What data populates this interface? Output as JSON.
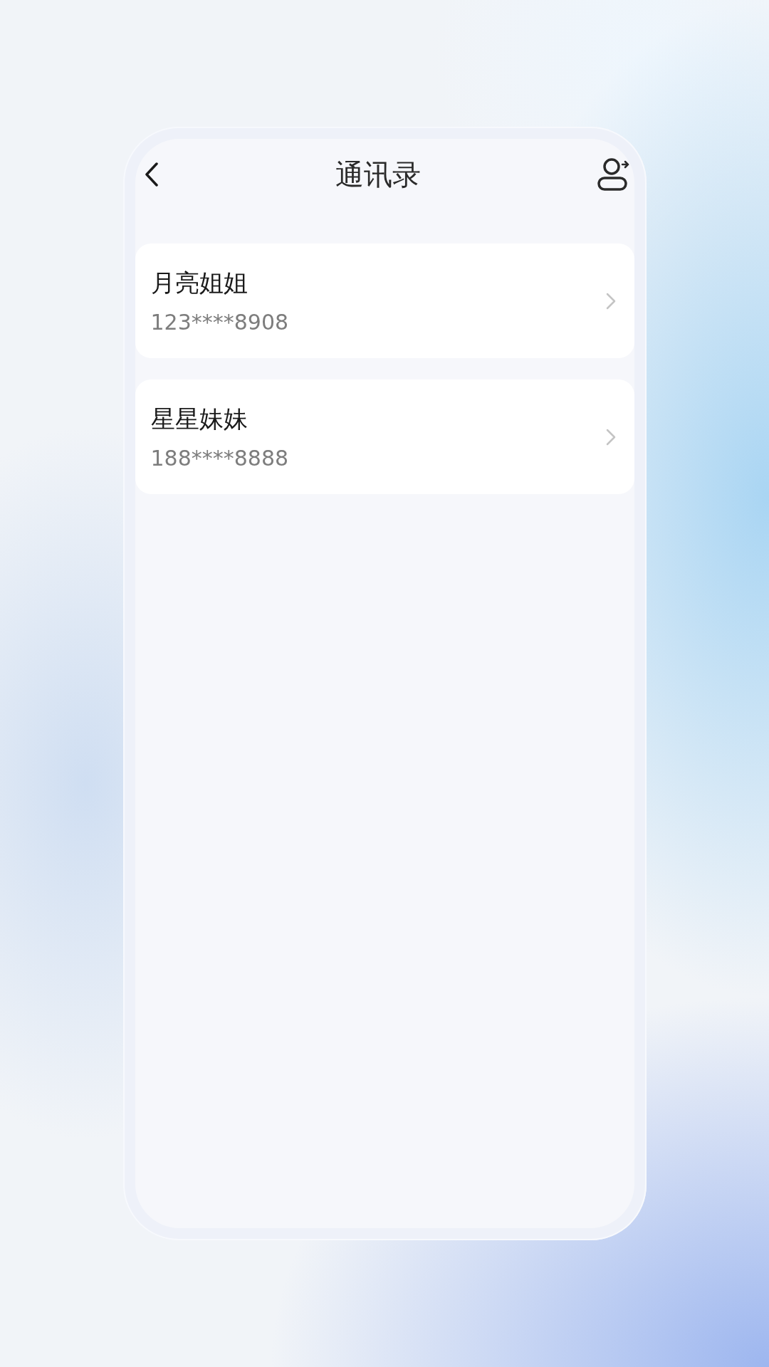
{
  "header": {
    "title": "通讯录"
  },
  "contacts": [
    {
      "name": "月亮姐姐",
      "phone": "123****8908"
    },
    {
      "name": "星星妹妹",
      "phone": "188****8888"
    }
  ]
}
